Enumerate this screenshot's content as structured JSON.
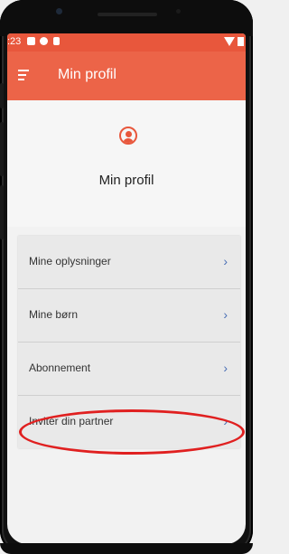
{
  "status_bar": {
    "time": ":23"
  },
  "app_bar": {
    "title": "Min profil"
  },
  "profile": {
    "heading": "Min profil"
  },
  "menu": {
    "items": [
      {
        "label": "Mine oplysninger"
      },
      {
        "label": "Mine børn"
      },
      {
        "label": "Abonnement"
      },
      {
        "label": "Invitér din partner"
      }
    ],
    "chevron": "›"
  },
  "colors": {
    "accent": "#ec6448",
    "status_bar": "#e8573c",
    "chevron": "#4a6fb5",
    "highlight_circle": "#e02020"
  },
  "icons": {
    "menu": "hamburger-menu-icon",
    "profile": "person-circle-icon",
    "chevron": "chevron-right-icon"
  }
}
